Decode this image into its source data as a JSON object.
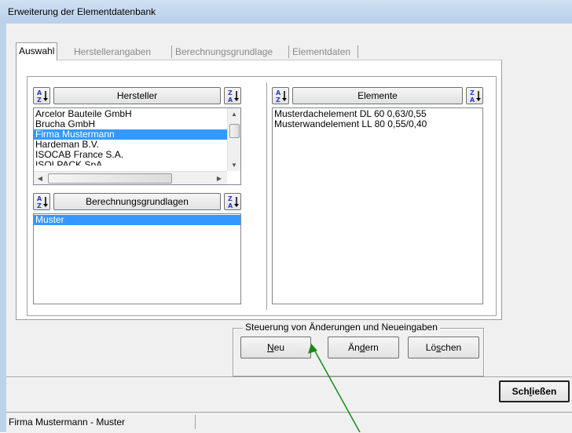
{
  "window": {
    "title": "Erweiterung der Elementdatenbank"
  },
  "tabs": [
    {
      "label": "Auswahl",
      "active": true
    },
    {
      "label": "Herstellerangaben",
      "active": false
    },
    {
      "label": "Berechnungsgrundlage",
      "active": false
    },
    {
      "label": "Elementdaten",
      "active": false
    }
  ],
  "manufacturers": {
    "header_label": "Hersteller",
    "sort_asc_icon": "sort-ascending-icon",
    "sort_desc_icon": "sort-descending-icon",
    "items": [
      {
        "label": "Arcelor Bauteile GmbH",
        "selected": false
      },
      {
        "label": "Brucha GmbH",
        "selected": false
      },
      {
        "label": "Firma Mustermann",
        "selected": true
      },
      {
        "label": "Hardeman B.V.",
        "selected": false
      },
      {
        "label": "ISOCAB France S.A.",
        "selected": false
      },
      {
        "label": "ISOLPACK SpA",
        "selected": false
      }
    ]
  },
  "calc_basis": {
    "header_label": "Berechnungsgrundlagen",
    "items": [
      {
        "label": "Muster",
        "selected": true
      }
    ]
  },
  "elements": {
    "header_label": "Elemente",
    "items": [
      {
        "label": "Musterdachelement DL 60 0,63/0,55"
      },
      {
        "label": "Musterwandelement LL 80 0,55/0,40"
      }
    ]
  },
  "control_group": {
    "label": "Steuerung von Änderungen und Neueingaben",
    "new_label": "Neu",
    "new_accel": "N",
    "new_rest": "eu",
    "edit_label": "Ändern",
    "edit_pre": "Än",
    "edit_accel": "d",
    "edit_post": "ern",
    "delete_label": "Löschen",
    "delete_pre": "Lö",
    "delete_accel": "s",
    "delete_post": "chen"
  },
  "close_button": {
    "label": "Schließen",
    "pre": "Sch",
    "accel": "l",
    "post": "ießen"
  },
  "status": {
    "text": "Firma Mustermann - Muster"
  },
  "annotation": {
    "arrow_color": "#1a8a1a"
  },
  "colors": {
    "selection": "#3399ff",
    "title_bar": "#bcd3ea"
  }
}
